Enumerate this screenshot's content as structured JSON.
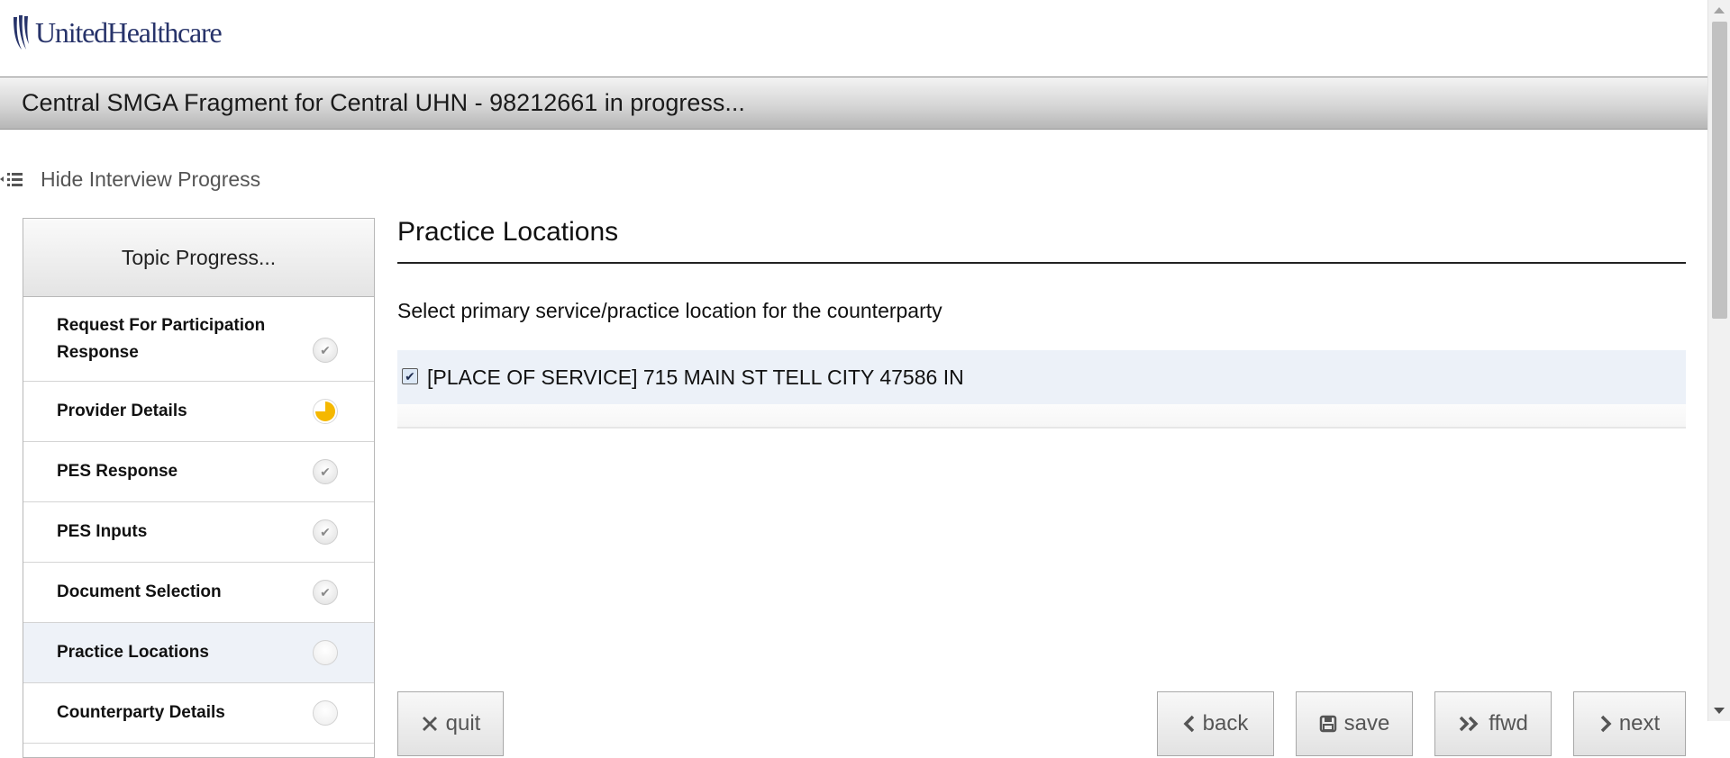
{
  "logo": {
    "text": "UnitedHealthcare"
  },
  "header": {
    "title": "Central SMGA Fragment for Central UHN - 98212661 in progress..."
  },
  "toggle_progress": {
    "label": "Hide Interview Progress"
  },
  "sidebar": {
    "heading": "Topic Progress...",
    "topics": [
      {
        "label": "Request For Participation Response",
        "status": "complete"
      },
      {
        "label": "Provider Details",
        "status": "in-progress"
      },
      {
        "label": "PES Response",
        "status": "complete"
      },
      {
        "label": "PES Inputs",
        "status": "complete"
      },
      {
        "label": "Document Selection",
        "status": "complete"
      },
      {
        "label": "Practice Locations",
        "status": "not-started",
        "current": true
      },
      {
        "label": "Counterparty Details",
        "status": "not-started"
      }
    ]
  },
  "main": {
    "title": "Practice Locations",
    "instructions": "Select primary service/practice location for the counterparty",
    "location": {
      "label": "[PLACE OF SERVICE] 715 MAIN ST TELL CITY 47586 IN",
      "checked": true
    }
  },
  "buttons": {
    "quit": "quit",
    "back": "back",
    "save": "save",
    "ffwd": "ffwd",
    "next": "next"
  },
  "colors": {
    "brand": "#27336a",
    "in_progress": "#f5b800",
    "active_row": "#eef2f8"
  }
}
